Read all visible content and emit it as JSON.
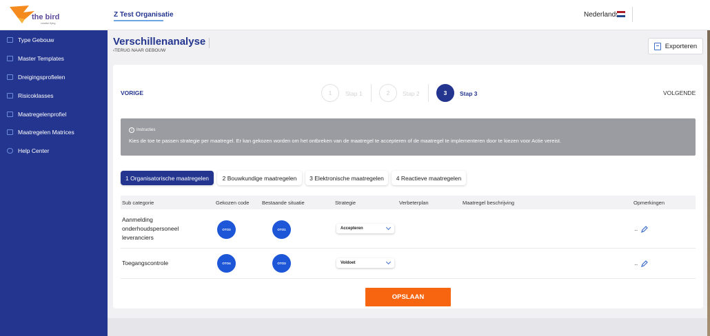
{
  "header": {
    "logo_text": "the bird",
    "logo_subtext": "creative flying",
    "organisation": "Z Test Organisatie",
    "language": "Nederlands",
    "flag_colors": [
      "#ae1c28",
      "#ffffff",
      "#21468b"
    ]
  },
  "sidebar": {
    "items": [
      {
        "label": "Type Gebouw",
        "icon": "building-icon"
      },
      {
        "label": "Master Templates",
        "icon": "template-icon"
      },
      {
        "label": "Dreigingsprofielen",
        "icon": "threat-icon"
      },
      {
        "label": "Risicoklasses",
        "icon": "risk-icon"
      },
      {
        "label": "Maatregelenprofiel",
        "icon": "profile-icon"
      },
      {
        "label": "Maatregelen Matrices",
        "icon": "matrix-icon"
      },
      {
        "label": "Help Center",
        "icon": "help-icon"
      }
    ]
  },
  "page": {
    "title": "Verschillenanalyse",
    "back_link": "TERUG NAAR GEBOUW",
    "export_label": "Exporteren"
  },
  "stepper": {
    "prev_label": "VORIGE",
    "next_label": "VOLGENDE",
    "steps": [
      {
        "number": "1",
        "label": "Stap 1",
        "active": false
      },
      {
        "number": "2",
        "label": "Stap 2",
        "active": false
      },
      {
        "number": "3",
        "label": "Stap 3",
        "active": true
      }
    ]
  },
  "instructions": {
    "title": "Instructies",
    "text": "Kies de toe te passen strategie per maatregel. Er kan gekozen worden om het ontbreken van de maatregel te accepteren of de maatregel te implementeren door te kiezen voor Actie vereist."
  },
  "tabs": [
    {
      "label": "1 Organisatorische maatregelen",
      "active": true
    },
    {
      "label": "2 Bouwkundige maatregelen",
      "active": false
    },
    {
      "label": "3 Elektronische maatregelen",
      "active": false
    },
    {
      "label": "4 Reactieve maatregelen",
      "active": false
    }
  ],
  "table": {
    "columns": [
      "Sub categorie",
      "Gekozen code",
      "Bestaande situatie",
      "Strategie",
      "Verbeterplan",
      "Maatregel beschrijving",
      "Opmerkingen"
    ],
    "rows": [
      {
        "sub_categorie": [
          "Aanmelding",
          "onderhoudspersoneel",
          "leveranciers"
        ],
        "gekozen_code": "OTO3",
        "bestaande_situatie": "OTO1",
        "strategie": "Accepteren",
        "opmerkingen": "..."
      },
      {
        "sub_categorie": [
          "Toegangscontrole"
        ],
        "gekozen_code": "OTO4",
        "bestaande_situatie": "OTO3",
        "strategie": "Voldoet",
        "opmerkingen": "..."
      }
    ]
  },
  "save_label": "OPSLAAN",
  "colors": {
    "primary": "#23358f",
    "accent": "#f76511",
    "badge": "#1e56d8",
    "instructions_bg": "#9b9ca1"
  }
}
